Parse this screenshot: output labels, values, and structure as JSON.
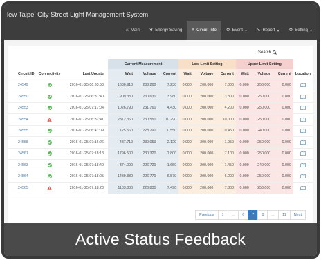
{
  "app": {
    "title": "lew Taipei City Street Light Management System"
  },
  "nav": {
    "items": [
      {
        "label": "Main",
        "icon": "home-icon"
      },
      {
        "label": "Energy Saving",
        "icon": "leaf-icon"
      },
      {
        "label": "Circuit Info",
        "icon": "circuit-icon",
        "active": true
      },
      {
        "label": "Event",
        "icon": "gears-icon",
        "dropdown": true
      },
      {
        "label": "Report",
        "icon": "chart-icon",
        "dropdown": true
      },
      {
        "label": "Setting",
        "icon": "settings-icon",
        "dropdown": true
      }
    ]
  },
  "search": {
    "label": "Search",
    "icon": "search-icon"
  },
  "table": {
    "groups": {
      "current": "Current Measurement",
      "low": "Low Limit Setting",
      "upper": "Upper Limit Setting"
    },
    "columns": {
      "id": "Circuit ID",
      "connectivity": "Connectivity",
      "last_update": "Last Update",
      "watt": "Watt",
      "voltage": "Voltage",
      "current": "Current",
      "location": "Location"
    },
    "rows": [
      {
        "id": "24549",
        "status": "ok",
        "date": "2016-01-25 06:33:53",
        "cw": "1680.910",
        "cv": "233.260",
        "cc": "7.230",
        "lw": "0.000",
        "lv": "200.000",
        "lc": "7.000",
        "uw": "0.000",
        "uv": "250.000",
        "uc": "0.000"
      },
      {
        "id": "24550",
        "status": "ok",
        "date": "2016-01-25 06:31:40",
        "cw": "909.330",
        "cv": "230.630",
        "cc": "3.980",
        "lw": "0.000",
        "lv": "200.000",
        "lc": "3.800",
        "uw": "0.000",
        "uv": "250.000",
        "uc": "0.000"
      },
      {
        "id": "24553",
        "status": "ok",
        "date": "2016-01-25 07:17:04",
        "cw": "1026.790",
        "cv": "231.760",
        "cc": "4.430",
        "lw": "0.000",
        "lv": "200.000",
        "lc": "4.200",
        "uw": "0.000",
        "uv": "250.000",
        "uc": "0.000"
      },
      {
        "id": "24554",
        "status": "warn",
        "date": "2016-01-25 06:32:41",
        "cw": "2372.360",
        "cv": "230.550",
        "cc": "10.290",
        "lw": "0.000",
        "lv": "200.000",
        "lc": "10.000",
        "uw": "0.000",
        "uv": "250.000",
        "uc": "0.000"
      },
      {
        "id": "24555",
        "status": "ok",
        "date": "2016-01-25 06:41:09",
        "cw": "125.560",
        "cv": "228.290",
        "cc": "0.550",
        "lw": "0.000",
        "lv": "200.000",
        "lc": "0.450",
        "uw": "0.000",
        "uv": "240.000",
        "uc": "0.000"
      },
      {
        "id": "24558",
        "status": "ok",
        "date": "2016-01-25 07:16:26",
        "cw": "487.710",
        "cv": "230.050",
        "cc": "2.120",
        "lw": "0.000",
        "lv": "200.000",
        "lc": "1.950",
        "uw": "0.000",
        "uv": "250.000",
        "uc": "0.000"
      },
      {
        "id": "24561",
        "status": "ok",
        "date": "2016-01-25 07:18:18",
        "cw": "1796.500",
        "cv": "230.320",
        "cc": "7.800",
        "lw": "0.000",
        "lv": "200.000",
        "lc": "7.100",
        "uw": "0.000",
        "uv": "250.000",
        "uc": "0.000"
      },
      {
        "id": "24563",
        "status": "ok",
        "date": "2016-01-25 07:18:40",
        "cw": "374.090",
        "cv": "226.720",
        "cc": "1.650",
        "lw": "0.000",
        "lv": "200.000",
        "lc": "1.450",
        "uw": "0.000",
        "uv": "240.000",
        "uc": "0.000"
      },
      {
        "id": "24564",
        "status": "ok",
        "date": "2016-01-25 07:18:05",
        "cw": "1489.880",
        "cv": "226.770",
        "cc": "6.570",
        "lw": "0.000",
        "lv": "200.000",
        "lc": "6.200",
        "uw": "0.000",
        "uv": "250.000",
        "uc": "0.000"
      },
      {
        "id": "24565",
        "status": "warn",
        "date": "2016-01-25 07:18:23",
        "cw": "1103.830",
        "cv": "226.830",
        "cc": "7.490",
        "lw": "0.000",
        "lv": "200.000",
        "lc": "7.300",
        "uw": "0.000",
        "uv": "250.000",
        "uc": "0.000"
      }
    ]
  },
  "pagination": {
    "previous": "Previous",
    "pages": [
      "1",
      "...",
      "6",
      "7",
      "8",
      "...",
      "11"
    ],
    "current": "7",
    "next": "Next"
  },
  "caption": "Active Status Feedback",
  "colors": {
    "navbar": "#3d3d3d",
    "ok": "#5cb85c",
    "warn": "#d9534f",
    "link": "#4f7fa6",
    "current_group": "#d6e1ea",
    "low_group": "#f8dfc8",
    "upper_group": "#f6cfcf"
  }
}
